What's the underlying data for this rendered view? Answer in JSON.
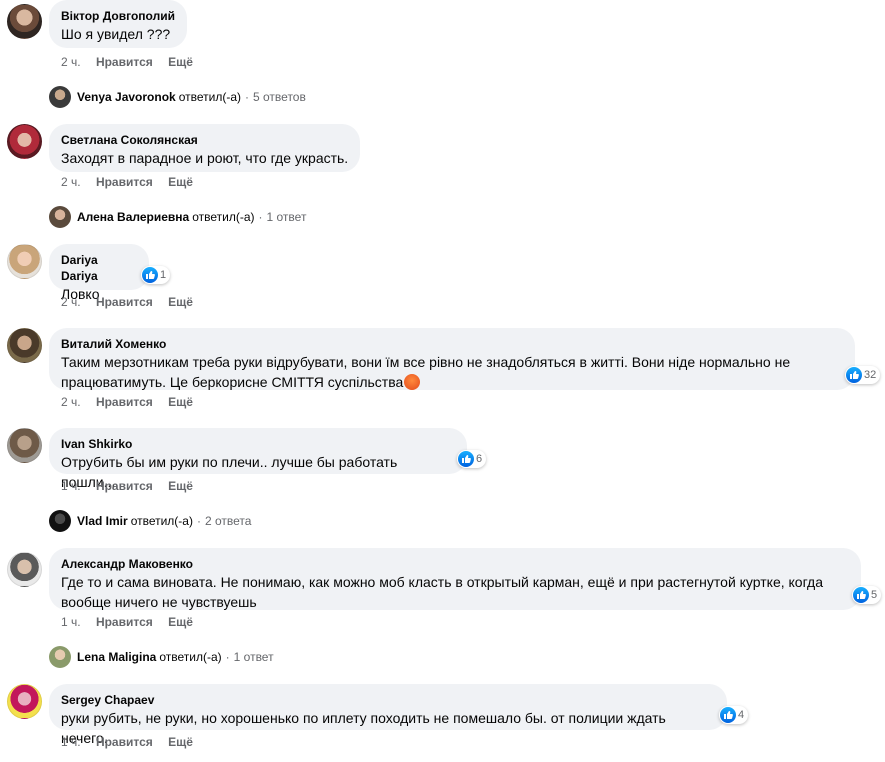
{
  "ui": {
    "like_label": "Нравится",
    "more_label": "Ещё",
    "separator": "·"
  },
  "comments": [
    {
      "author": "Віктор Довгополий",
      "text": "Шо я увидел ???",
      "time": "2 ч.",
      "reactions": ""
    },
    {
      "author": "Светлана Соколянская",
      "text": "Заходят в парадное и роют, что где украсть.",
      "time": "2 ч.",
      "reactions": ""
    },
    {
      "author": "Dariya Dariya",
      "text": "Ловко",
      "time": "2 ч.",
      "reactions": "1"
    },
    {
      "author": "Виталий Хоменко",
      "text_line1": "Таким мерзотникам треба руки відрубувати, вони їм все рівно не знадобляться в житті. Вони ніде нормально не",
      "text_line2": "працюватимуть. Це беркорисне СМІТТЯ суспільства",
      "time": "2 ч.",
      "reactions": "32"
    },
    {
      "author": "Ivan Shkirko",
      "text": "Отрубить бы им руки по плечи.. лучше бы работать пошли...",
      "time": "1 ч.",
      "reactions": "6"
    },
    {
      "author": "Александр Маковенко",
      "text_line1": "Где то и сама виновата. Не понимаю, как можно моб класть в открытый карман, ещё и при растегнутой куртке, когда",
      "text_line2": "вообще ничего не чувствуешь",
      "time": "1 ч.",
      "reactions": "5"
    },
    {
      "author": "Sergey Chapaev",
      "text": "руки рубить, не руки, но хорошенько по иплету походить не помешало бы. от полиции ждать нечего.",
      "time": "1 ч.",
      "reactions": "4"
    }
  ],
  "replies": [
    {
      "name": "Venya Javoronok",
      "verb": "ответил(-а)",
      "count": "5 ответов"
    },
    {
      "name": "Алена Валериевна",
      "verb": "ответил(-а)",
      "count": "1 ответ"
    },
    {
      "name": "Vlad Imir",
      "verb": "ответил(-а)",
      "count": "2 ответа"
    },
    {
      "name": "Lena Maligina",
      "verb": "ответил(-а)",
      "count": "1 ответ"
    }
  ],
  "colors": {
    "bubble": "#f0f2f5",
    "secondary_text": "#65676b",
    "like_blue": "#1877f2"
  }
}
